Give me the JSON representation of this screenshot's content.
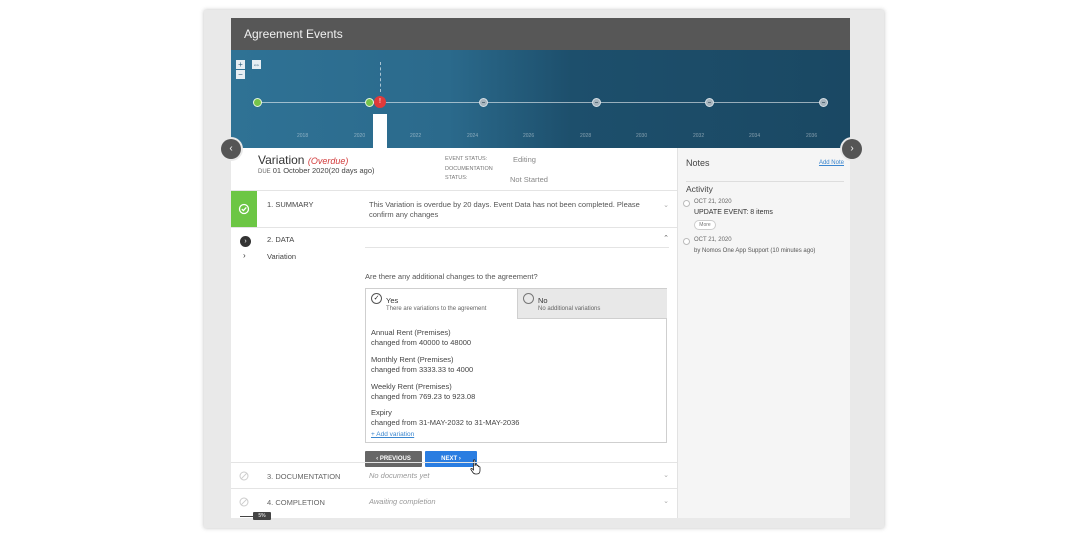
{
  "header": {
    "title": "Agreement Events"
  },
  "timeline": {
    "zoom_in": "+",
    "zoom_out": "−",
    "fit": "⇔",
    "years": [
      "2018",
      "2020",
      "2022",
      "2024",
      "2026",
      "2028",
      "2030",
      "2032",
      "2034",
      "2036"
    ],
    "current_marker": "!",
    "prev_icon": "‹",
    "next_icon": "›"
  },
  "event": {
    "title": "Variation",
    "overdue": "(Overdue)",
    "due_label": "DUE",
    "due_text": "01 October 2020(20 days ago)",
    "event_status_label": "EVENT STATUS:",
    "event_status_value": "Editing",
    "documentation_label": "DOCUMENTATION",
    "documentation_label2": "STATUS:",
    "documentation_value": "Not Started"
  },
  "steps": {
    "summary": {
      "label": "1. SUMMARY",
      "desc_line1": "This Variation is overdue by 20 days. Event Data has not been completed. Please",
      "desc_line2": "confirm any changes"
    },
    "data": {
      "label": "2. DATA",
      "sub_label": "Variation",
      "sub_arrow": "›"
    },
    "documentation": {
      "label": "3. DOCUMENTATION",
      "desc": "No documents yet"
    },
    "completion": {
      "label": "4. COMPLETION",
      "desc": "Awaiting completion"
    }
  },
  "data_step": {
    "question": "Are there any additional changes to the agreement?",
    "yes": {
      "title": "Yes",
      "sub": "There are variations to the agreement",
      "mark": "✓"
    },
    "no": {
      "title": "No",
      "sub": "No additional variations"
    },
    "changes": [
      {
        "title": "Annual Rent (Premises)",
        "detail": "changed from 40000 to 48000"
      },
      {
        "title": "Monthly Rent (Premises)",
        "detail": "changed from 3333.33 to 4000"
      },
      {
        "title": "Weekly Rent (Premises)",
        "detail": "changed from 769.23 to 923.08"
      },
      {
        "title": "Expiry",
        "detail": "changed from 31-MAY-2032 to 31-MAY-2036"
      }
    ],
    "add_variation": "+ Add variation",
    "previous_label": "‹  PREVIOUS",
    "next_label": "NEXT  ›"
  },
  "notes": {
    "title": "Notes",
    "add_note": "Add Note",
    "activity_title": "Activity",
    "items": [
      {
        "date": "OCT 21, 2020",
        "text": "UPDATE EVENT: 8 items",
        "more": "More"
      },
      {
        "date": "OCT 21, 2020",
        "by": "by Nomos One App Support (10 minutes ago)"
      }
    ]
  },
  "progress": {
    "label": "5%",
    "value": 0.05
  },
  "colors": {
    "accent_blue": "#2a7de1",
    "success_green": "#6cc644",
    "overdue_red": "#d23c3c",
    "header_gray": "#575757"
  }
}
